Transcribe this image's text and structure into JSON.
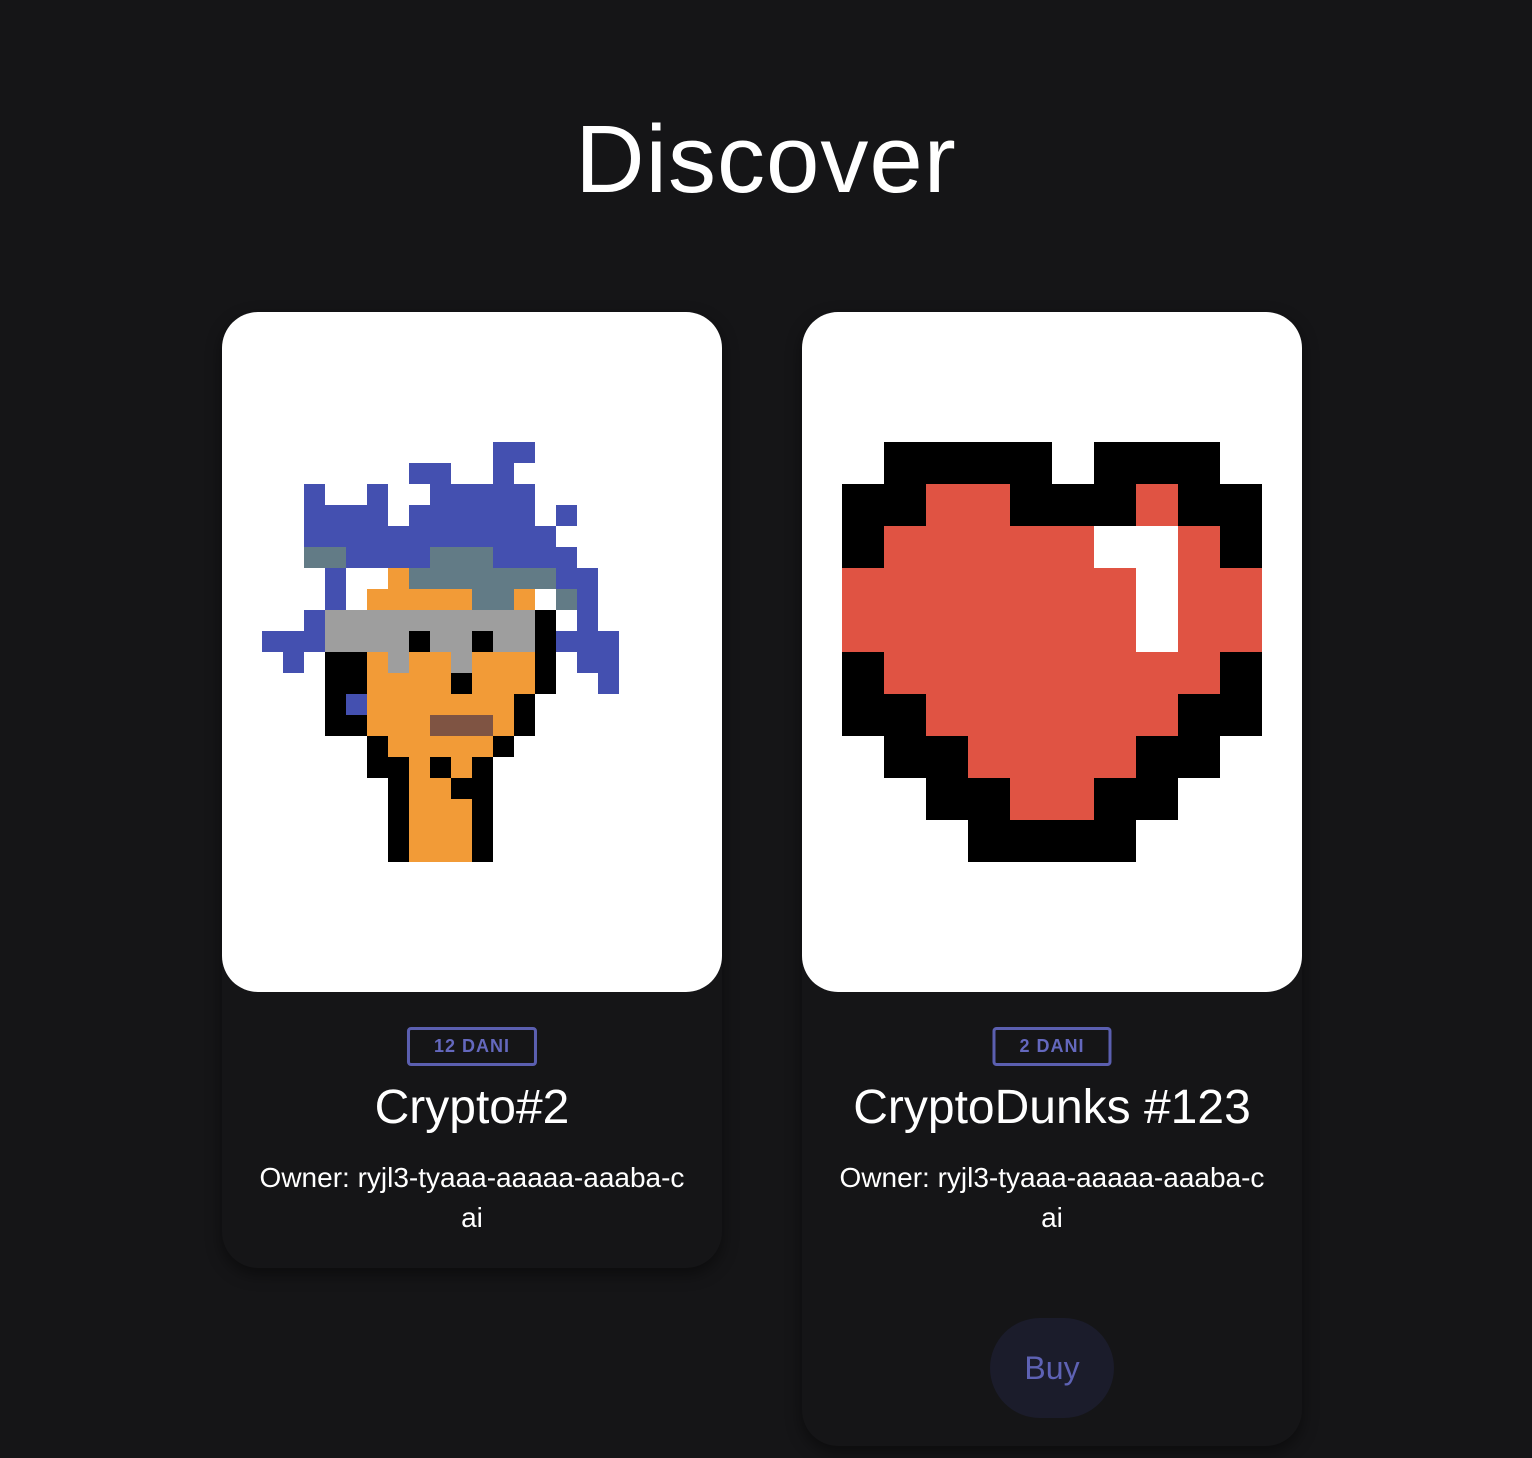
{
  "page": {
    "title": "Discover"
  },
  "cards": [
    {
      "price": "12 DANI",
      "name": "Crypto#2",
      "owner": "Owner: ryjl3-tyaaa-aaaaa-aaaba-cai",
      "image": "pixel-punk-avatar"
    },
    {
      "price": "2 DANI",
      "name": "CryptoDunks #123",
      "owner": "Owner: ryjl3-tyaaa-aaaaa-aaaba-cai",
      "image": "pixel-heart",
      "buy_label": "Buy"
    }
  ],
  "colors": {
    "background": "#151517",
    "card_image_bg": "#ffffff",
    "accent": "#5b5fb0",
    "buy_button_bg": "#1b1c2b",
    "heart_red": "#e05343",
    "punk_skin": "#f29b37",
    "punk_hair": "#4450b0",
    "punk_hair_grey": "#627b86",
    "punk_glasses": "#9e9e9e",
    "punk_mouth": "#7f5443"
  }
}
